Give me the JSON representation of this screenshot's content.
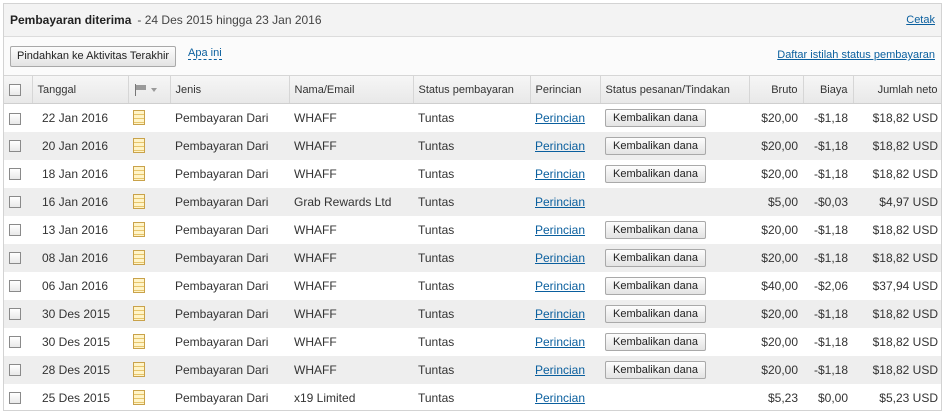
{
  "header": {
    "title": "Pembayaran diterima",
    "date_range": "- 24 Des 2015 hingga 23 Jan 2016",
    "print_link": "Cetak"
  },
  "toolbar": {
    "move_button": "Pindahkan ke Aktivitas Terakhir",
    "help_link": "Apa ini",
    "glossary_link": "Daftar istilah status pembayaran"
  },
  "icons": {
    "flag": "flag-icon",
    "note": "note-icon",
    "checkbox": "checkbox"
  },
  "columns": {
    "date": "Tanggal",
    "type": "Jenis",
    "name": "Nama/Email",
    "status": "Status pembayaran",
    "details": "Perincian",
    "order_status": "Status pesanan/Tindakan",
    "gross": "Bruto",
    "fee": "Biaya",
    "net": "Jumlah neto"
  },
  "rows": [
    {
      "date": "22 Jan 2016",
      "type": "Pembayaran Dari",
      "name": "WHAFF",
      "status": "Tuntas",
      "details": "Perincian",
      "action": "Kembalikan dana",
      "gross": "$20,00",
      "fee": "-$1,18",
      "net": "$18,82 USD"
    },
    {
      "date": "20 Jan 2016",
      "type": "Pembayaran Dari",
      "name": "WHAFF",
      "status": "Tuntas",
      "details": "Perincian",
      "action": "Kembalikan dana",
      "gross": "$20,00",
      "fee": "-$1,18",
      "net": "$18,82 USD"
    },
    {
      "date": "18 Jan 2016",
      "type": "Pembayaran Dari",
      "name": "WHAFF",
      "status": "Tuntas",
      "details": "Perincian",
      "action": "Kembalikan dana",
      "gross": "$20,00",
      "fee": "-$1,18",
      "net": "$18,82 USD"
    },
    {
      "date": "16 Jan 2016",
      "type": "Pembayaran Dari",
      "name": "Grab Rewards Ltd",
      "status": "Tuntas",
      "details": "Perincian",
      "action": "",
      "gross": "$5,00",
      "fee": "-$0,03",
      "net": "$4,97 USD"
    },
    {
      "date": "13 Jan 2016",
      "type": "Pembayaran Dari",
      "name": "WHAFF",
      "status": "Tuntas",
      "details": "Perincian",
      "action": "Kembalikan dana",
      "gross": "$20,00",
      "fee": "-$1,18",
      "net": "$18,82 USD"
    },
    {
      "date": "08 Jan 2016",
      "type": "Pembayaran Dari",
      "name": "WHAFF",
      "status": "Tuntas",
      "details": "Perincian",
      "action": "Kembalikan dana",
      "gross": "$20,00",
      "fee": "-$1,18",
      "net": "$18,82 USD"
    },
    {
      "date": "06 Jan 2016",
      "type": "Pembayaran Dari",
      "name": "WHAFF",
      "status": "Tuntas",
      "details": "Perincian",
      "action": "Kembalikan dana",
      "gross": "$40,00",
      "fee": "-$2,06",
      "net": "$37,94 USD"
    },
    {
      "date": "30 Des 2015",
      "type": "Pembayaran Dari",
      "name": "WHAFF",
      "status": "Tuntas",
      "details": "Perincian",
      "action": "Kembalikan dana",
      "gross": "$20,00",
      "fee": "-$1,18",
      "net": "$18,82 USD"
    },
    {
      "date": "30 Des 2015",
      "type": "Pembayaran Dari",
      "name": "WHAFF",
      "status": "Tuntas",
      "details": "Perincian",
      "action": "Kembalikan dana",
      "gross": "$20,00",
      "fee": "-$1,18",
      "net": "$18,82 USD"
    },
    {
      "date": "28 Des 2015",
      "type": "Pembayaran Dari",
      "name": "WHAFF",
      "status": "Tuntas",
      "details": "Perincian",
      "action": "Kembalikan dana",
      "gross": "$20,00",
      "fee": "-$1,18",
      "net": "$18,82 USD"
    },
    {
      "date": "25 Des 2015",
      "type": "Pembayaran Dari",
      "name": "x19 Limited",
      "status": "Tuntas",
      "details": "Perincian",
      "action": "",
      "gross": "$5,23",
      "fee": "$0,00",
      "net": "$5,23 USD"
    }
  ]
}
